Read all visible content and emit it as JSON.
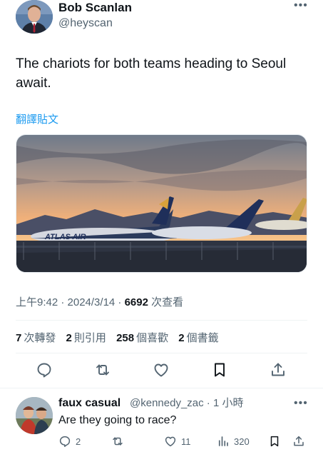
{
  "tweet": {
    "author_name": "Bob Scanlan",
    "author_handle": "@heyscan",
    "more_icon": "more-horizontal-icon",
    "text": "The chariots for both teams heading to Seoul await.",
    "translate_label": "翻譯貼文",
    "timestamp": "上午9:42 · 2024/3/14 · ",
    "views_count": "6692",
    "views_label": " 次查看",
    "stats": {
      "reposts_count": "7",
      "reposts_label": "次轉發",
      "quotes_count": "2",
      "quotes_label": "則引用",
      "likes_count": "258",
      "likes_label": "個喜歡",
      "bookmarks_count": "2",
      "bookmarks_label": "個書籤"
    },
    "image_text": "ATLAS AIR",
    "actions": [
      "reply-icon",
      "retweet-icon",
      "like-icon",
      "bookmark-icon",
      "share-icon"
    ]
  },
  "reply": {
    "author_name": "faux casual",
    "author_handle": "@kennedy_zac · 1 小時",
    "text": "Are they going to race?",
    "reply_count": "2",
    "retweet_count": "",
    "like_count": "11",
    "views_count": "320"
  },
  "colors": {
    "text_primary": "#0f1419",
    "text_secondary": "#536471",
    "link": "#1d9bf0",
    "divider": "#eff3f4"
  }
}
